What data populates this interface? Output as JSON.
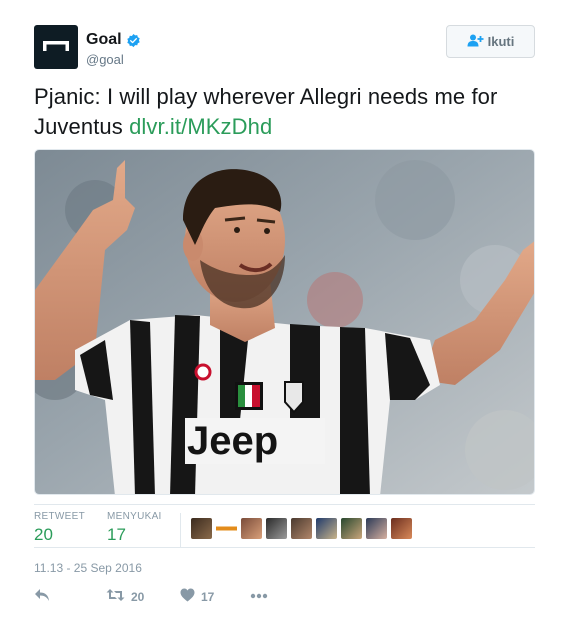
{
  "account": {
    "display_name": "Goal",
    "handle": "@goal",
    "avatar_icon": "goal-logo-icon",
    "verified_icon": "verified-badge-icon"
  },
  "follow_button": {
    "label": "Ikuti",
    "icon": "add-user-icon"
  },
  "tweet": {
    "text": "Pjanic: I will play wherever Allegri needs me for Juventus ",
    "link": "dlvr.it/MKzDhd",
    "photo_description_icon": "player-photo",
    "photo_text": {
      "shirt_sponsor": "Jeep"
    }
  },
  "stats": {
    "retweet_label": "RETWEET",
    "retweet_count": "20",
    "like_label": "MENYUKAI",
    "like_count": "17",
    "liker_avatars": [
      "avatar-1",
      "avatar-2",
      "avatar-3",
      "avatar-4",
      "avatar-5",
      "avatar-6",
      "avatar-7",
      "avatar-8",
      "avatar-9"
    ]
  },
  "timestamp": "11.13 - 25 Sep 2016",
  "actions": {
    "reply_icon": "reply-icon",
    "retweet_icon": "retweet-icon",
    "retweet_count": "20",
    "like_icon": "heart-icon",
    "like_count": "17",
    "more_icon": "more-icon"
  },
  "colors": {
    "link": "#2b9c5a",
    "muted": "#8899a6",
    "verified": "#1da1f2"
  }
}
